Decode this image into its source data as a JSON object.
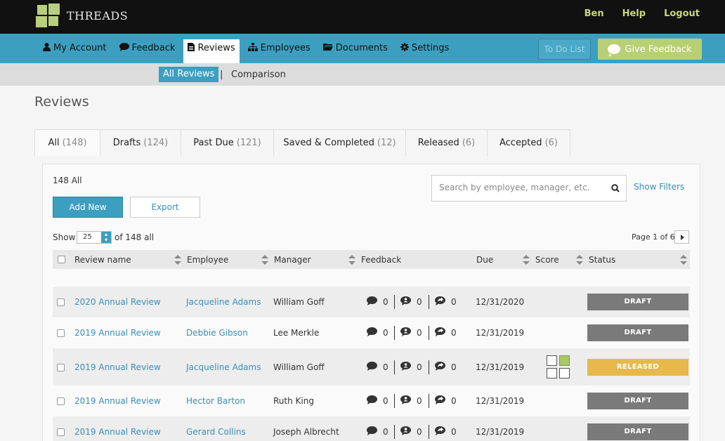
{
  "app": {
    "brand": "THREADS"
  },
  "toplinks": [
    "Ben",
    "Help",
    "Logout"
  ],
  "nav": {
    "items": [
      {
        "label": "My Account",
        "icon": "user-icon"
      },
      {
        "label": "Feedback",
        "icon": "comment-icon"
      },
      {
        "label": "Reviews",
        "icon": "file-icon"
      },
      {
        "label": "Employees",
        "icon": "sitemap-icon"
      },
      {
        "label": "Documents",
        "icon": "folder-icon"
      },
      {
        "label": "Settings",
        "icon": "gear-icon"
      }
    ],
    "active": "Reviews",
    "todo_label": "To Do List",
    "give_feedback_label": "Give Feedback"
  },
  "subnav": {
    "all_reviews": "All Reviews",
    "separator": "|",
    "comparison": "Comparison"
  },
  "page_title": "Reviews",
  "tabs": [
    {
      "label": "All",
      "count": "(148)"
    },
    {
      "label": "Drafts",
      "count": "(124)"
    },
    {
      "label": "Past Due",
      "count": "(121)"
    },
    {
      "label": "Saved & Completed",
      "count": "(12)"
    },
    {
      "label": "Released",
      "count": "(6)"
    },
    {
      "label": "Accepted",
      "count": "(6)"
    }
  ],
  "panel": {
    "count_label": "148 All",
    "search_placeholder": "Search by employee, manager, etc.",
    "show_filters": "Show Filters",
    "add_new": "Add New",
    "export": "Export",
    "show_label": "Show",
    "per_page": "25",
    "of_all": "of 148 all",
    "page_info": "Page 1 of 6"
  },
  "table": {
    "headers": [
      "Review name",
      "Employee",
      "Manager",
      "Feedback",
      "Due",
      "Score",
      "Status"
    ],
    "rows": [
      {
        "review": "2020 Annual Review",
        "employee": "Jacqueline Adams",
        "manager": "William Goff",
        "fb1": "0",
        "fb2": "0",
        "fb3": "0",
        "due": "12/31/2020",
        "status": "DRAFT",
        "score": false
      },
      {
        "review": "2019 Annual Review",
        "employee": "Debbie Gibson",
        "manager": "Lee Merkle",
        "fb1": "0",
        "fb2": "0",
        "fb3": "0",
        "due": "12/31/2019",
        "status": "DRAFT",
        "score": false
      },
      {
        "review": "2019 Annual Review",
        "employee": "Jacqueline Adams",
        "manager": "William Goff",
        "fb1": "0",
        "fb2": "0",
        "fb3": "0",
        "due": "12/31/2019",
        "status": "RELEASED",
        "score": true
      },
      {
        "review": "2019 Annual Review",
        "employee": "Hector Barton",
        "manager": "Ruth King",
        "fb1": "0",
        "fb2": "0",
        "fb3": "0",
        "due": "12/31/2019",
        "status": "DRAFT",
        "score": false
      },
      {
        "review": "2019 Annual Review",
        "employee": "Gerard Collins",
        "manager": "Joseph Albrecht",
        "fb1": "0",
        "fb2": "0",
        "fb3": "0",
        "due": "12/31/2019",
        "status": "DRAFT",
        "score": false
      }
    ]
  },
  "colors": {
    "nav": "#3d9fc0",
    "accent_green": "#b8cf74",
    "link": "#3a8fb7",
    "draft": "#7a7a7a",
    "released": "#e6b94a"
  }
}
